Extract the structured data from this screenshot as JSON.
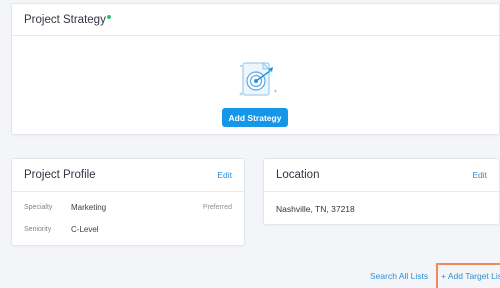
{
  "strategy_card": {
    "title": "Project Strategy",
    "add_button": "Add Strategy"
  },
  "profile_card": {
    "title": "Project Profile",
    "edit": "Edit",
    "rows": [
      {
        "key": "Specialty",
        "value": "Marketing",
        "tag": "Preferred"
      },
      {
        "key": "Seniority",
        "value": "C-Level",
        "tag": ""
      }
    ]
  },
  "location_card": {
    "title": "Location",
    "edit": "Edit",
    "value": "Nashville, TN, 37218"
  },
  "footer": {
    "search_all": "Search All Lists",
    "add_target": "+ Add Target List"
  },
  "colors": {
    "accent": "#1596e8",
    "link": "#2b8fd8",
    "status_dot": "#32c36c",
    "highlight_border": "#f08a5d"
  },
  "icons": {
    "strategy_illustration": "target-dart-icon",
    "status": "green-status-dot"
  }
}
